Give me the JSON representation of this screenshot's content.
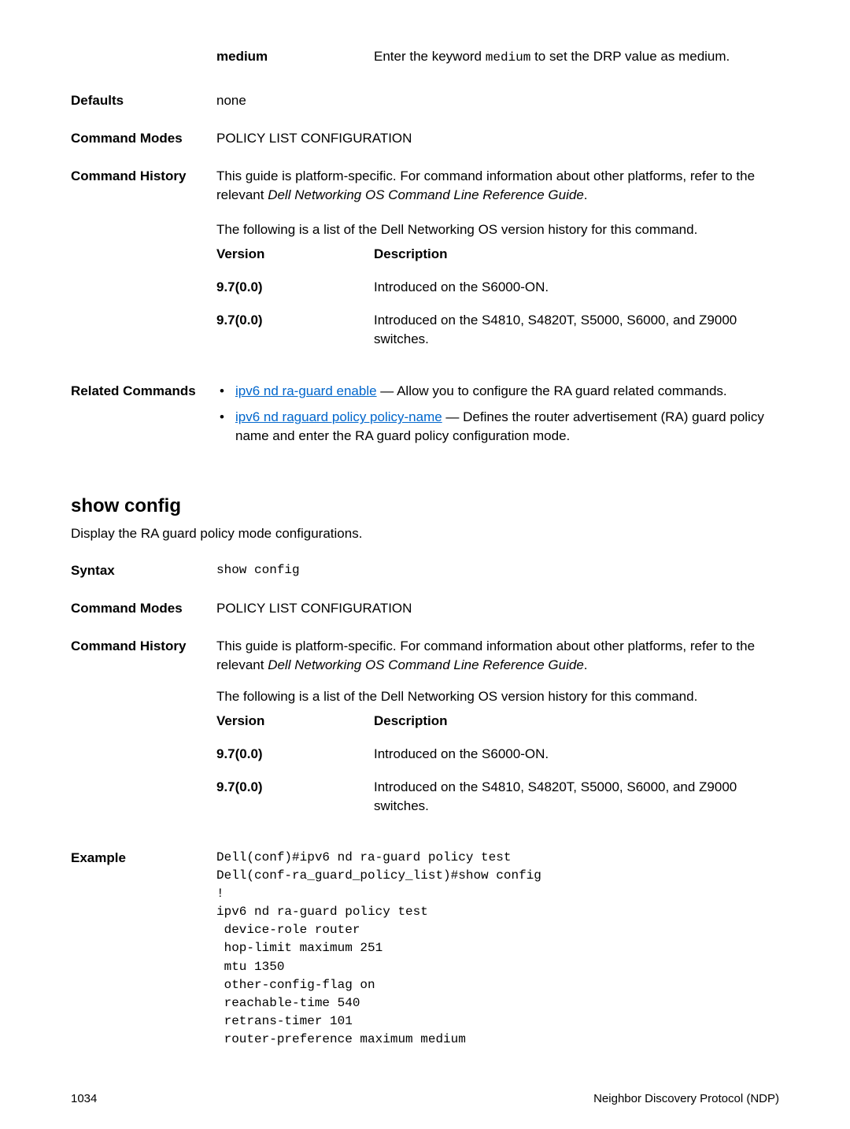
{
  "top": {
    "medium_label": "medium",
    "medium_desc_pre": "Enter the keyword ",
    "medium_code": "medium",
    "medium_desc_post": " to set the DRP value as medium."
  },
  "defaults": {
    "label": "Defaults",
    "value": "none"
  },
  "cmd_modes": {
    "label": "Command Modes",
    "value": "POLICY LIST CONFIGURATION"
  },
  "cmd_history": {
    "label": "Command History",
    "para1_pre": "This guide is platform-specific. For command information about other platforms, refer to the relevant ",
    "para1_italic": "Dell Networking OS Command Line Reference Guide",
    "para1_post": ".",
    "para2": "The following is a list of the Dell Networking OS version history for this command.",
    "col1": "Version",
    "col2": "Description",
    "rows": [
      {
        "v": "9.7(0.0)",
        "d": "Introduced on the S6000-ON."
      },
      {
        "v": "9.7(0.0)",
        "d": "Introduced on the S4810, S4820T, S5000, S6000, and Z9000 switches."
      }
    ]
  },
  "related": {
    "label": "Related Commands",
    "items": [
      {
        "link": "ipv6 nd ra-guard enable",
        "rest": " — Allow you to configure the RA guard related commands."
      },
      {
        "link": "ipv6 nd raguard policy policy-name",
        "rest": " — Defines the router advertisement (RA) guard policy name and enter the RA guard policy configuration mode."
      }
    ]
  },
  "showconfig": {
    "heading": "show config",
    "subtitle": "Display the RA guard policy mode configurations.",
    "syntax_label": "Syntax",
    "syntax_value": "show config",
    "modes_label": "Command Modes",
    "modes_value": "POLICY LIST CONFIGURATION",
    "history_label": "Command History",
    "para1_pre": "This guide is platform-specific. For command information about other platforms, refer to the relevant ",
    "para1_italic": "Dell Networking OS Command Line Reference Guide",
    "para1_post": ".",
    "para2": "The following is a list of the Dell Networking OS version history for this command.",
    "col1": "Version",
    "col2": "Description",
    "rows": [
      {
        "v": "9.7(0.0)",
        "d": "Introduced on the S6000-ON."
      },
      {
        "v": "9.7(0.0)",
        "d": "Introduced on the S4810, S4820T, S5000, S6000, and Z9000 switches."
      }
    ],
    "example_label": "Example",
    "example_text": "Dell(conf)#ipv6 nd ra-guard policy test\nDell(conf-ra_guard_policy_list)#show config\n!\nipv6 nd ra-guard policy test\n device-role router\n hop-limit maximum 251\n mtu 1350\n other-config-flag on\n reachable-time 540\n retrans-timer 101\n router-preference maximum medium"
  },
  "footer": {
    "page": "1034",
    "section": "Neighbor Discovery Protocol (NDP)"
  }
}
